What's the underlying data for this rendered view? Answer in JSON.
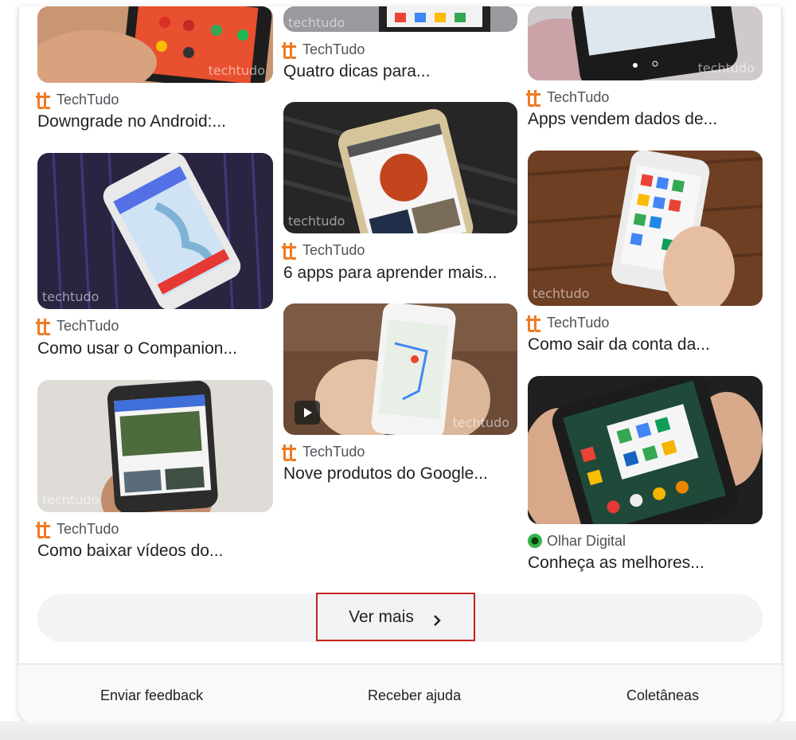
{
  "results": [
    {
      "source": "TechTudo",
      "title": "Downgrade no Android:..."
    },
    {
      "source": "TechTudo",
      "title": "Como usar o Companion..."
    },
    {
      "source": "TechTudo",
      "title": "Como baixar vídeos do..."
    },
    {
      "source": "TechTudo",
      "title": "Quatro dicas para..."
    },
    {
      "source": "TechTudo",
      "title": "6 apps para aprender mais..."
    },
    {
      "source": "TechTudo",
      "title": "Nove produtos do Google..."
    },
    {
      "source": "TechTudo",
      "title": "Apps vendem dados de..."
    },
    {
      "source": "TechTudo",
      "title": "Como sair da conta da..."
    },
    {
      "source": "Olhar Digital",
      "title": "Conheça as melhores..."
    }
  ],
  "watermark": "techtudo",
  "more_button": {
    "label": "Ver mais",
    "icon": "chevron-right-icon"
  },
  "footer": {
    "feedback": "Enviar feedback",
    "help": "Receber ajuda",
    "collections": "Coletâneas"
  },
  "colors": {
    "highlight_border": "#c5221f",
    "techtudo_brand": "#ef7a22",
    "olhar_digital_brand": "#37b34a"
  }
}
